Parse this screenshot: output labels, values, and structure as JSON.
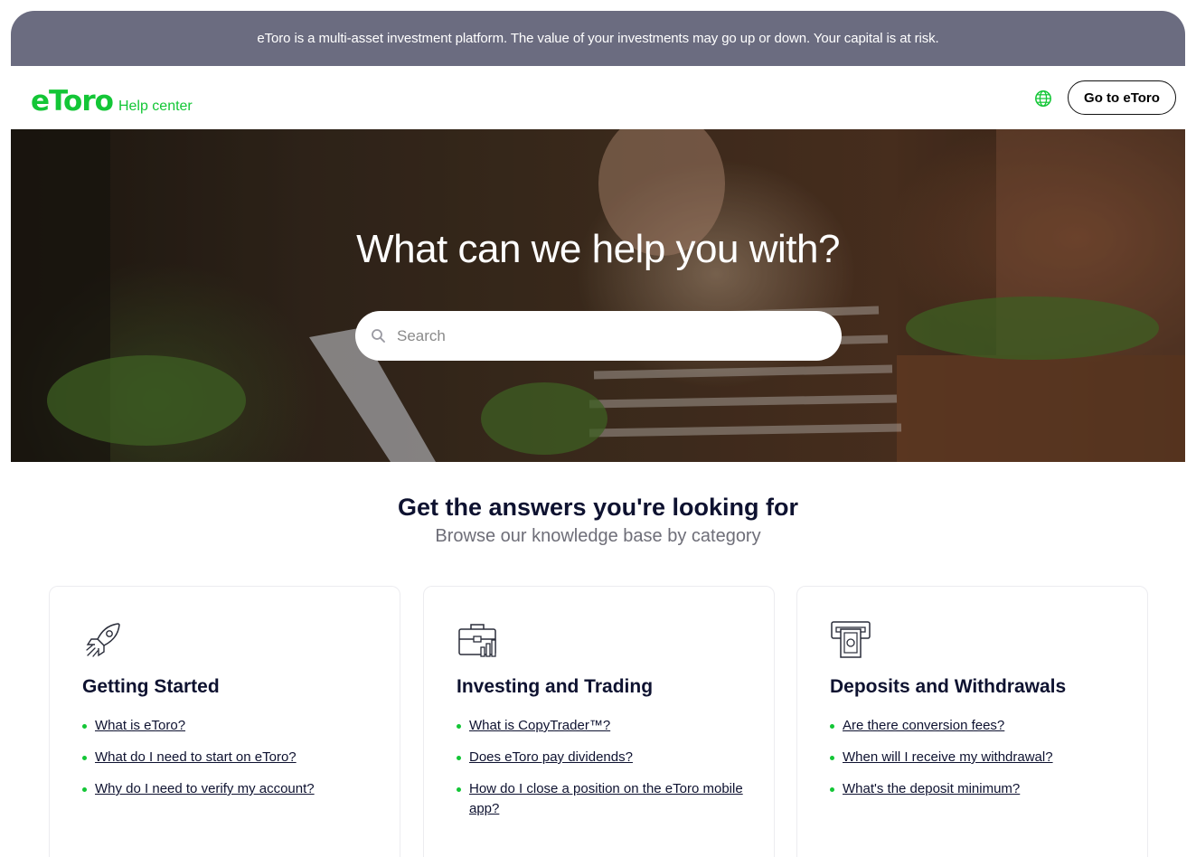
{
  "banner": {
    "text": "eToro is a multi-asset investment platform. The value of your investments may go up or down. Your capital is at risk."
  },
  "header": {
    "logo_text": "eToro",
    "logo_sub": "Help center",
    "globe_icon": "globe-icon",
    "cta_label": "Go to eToro"
  },
  "hero": {
    "title": "What can we help you with?",
    "search_placeholder": "Search",
    "search_icon": "search-icon"
  },
  "section": {
    "title": "Get the answers you're looking for",
    "subtitle": "Browse our knowledge base by category"
  },
  "cards": [
    {
      "icon": "rocket-icon",
      "title": "Getting Started",
      "links": [
        "What is eToro?",
        "What do I need to start on eToro?",
        "Why do I need to verify my account?"
      ]
    },
    {
      "icon": "briefcase-chart-icon",
      "title": "Investing and Trading",
      "links": [
        "What is CopyTrader™?",
        "Does eToro pay dividends?",
        "How do I close a position on the eToro mobile app?"
      ]
    },
    {
      "icon": "atm-cash-icon",
      "title": "Deposits and Withdrawals",
      "links": [
        "Are there conversion fees?",
        "When will I receive my withdrawal?",
        "What's the deposit minimum?"
      ]
    }
  ],
  "colors": {
    "brand_green": "#13c636",
    "banner_bg": "#6b6c80",
    "heading": "#0e1230"
  }
}
